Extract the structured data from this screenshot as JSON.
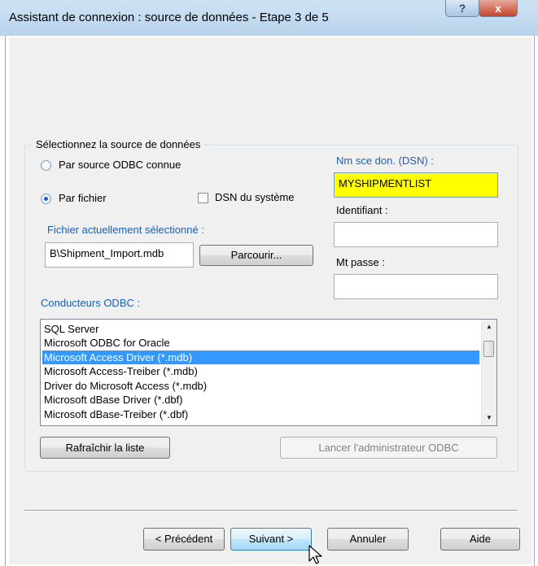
{
  "window": {
    "title": "Assistant de connexion : source de données - Etape 3 de 5",
    "help_label": "?",
    "close_label": "x"
  },
  "source_group": {
    "legend": "Sélectionnez la source de données",
    "radio_odbc_label": "Par source ODBC connue",
    "radio_file_label": "Par fichier",
    "selected_radio": "Par fichier",
    "system_dsn_label": "DSN du système",
    "system_dsn_checked": false,
    "current_file_label": "Fichier actuellement sélectionné :",
    "current_file_value": "B\\Shipment_Import.mdb",
    "browse_label": "Parcourir..."
  },
  "dsn": {
    "label": "Nm sce don. (DSN) :",
    "value": "MYSHIPMENTLIST",
    "highlight": "#ffff00"
  },
  "login": {
    "identifier_label": "Identifiant :",
    "identifier_value": "",
    "password_label": "Mt passe :",
    "password_value": ""
  },
  "drivers": {
    "label": "Conducteurs ODBC :",
    "items": [
      "SQL Server",
      "Microsoft ODBC for Oracle",
      "Microsoft Access Driver (*.mdb)",
      "Microsoft Access-Treiber (*.mdb)",
      "Driver do Microsoft Access (*.mdb)",
      "Microsoft dBase Driver (*.dbf)",
      "Microsoft dBase-Treiber (*.dbf)"
    ],
    "selected": "Microsoft Access Driver (*.mdb)",
    "selection_color": "#3399ff"
  },
  "actions": {
    "refresh_label": "Rafraîchir la liste",
    "launch_admin_label": "Lancer l'administrateur ODBC"
  },
  "footer": {
    "previous_label": "< Précédent",
    "next_label": "Suivant >",
    "cancel_label": "Annuler",
    "help_label": "Aide"
  }
}
